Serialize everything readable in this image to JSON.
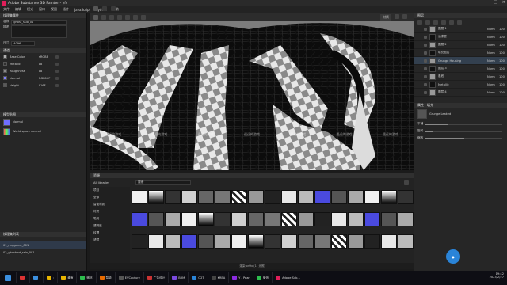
{
  "window": {
    "title": "Adobe Substance 3D Painter - yfs"
  },
  "menu": [
    "文件",
    "编辑",
    "模式",
    "窗口",
    "视图",
    "插件",
    "JavaScript",
    "Python",
    "帮助"
  ],
  "left": {
    "section_title": "纹理集属性",
    "name_label": "名称",
    "name_value": "ghost_sslo_01",
    "sub_label": "描述",
    "resolution_label": "尺寸",
    "resolution_value": "4096",
    "channels_title": "通道",
    "channels": [
      {
        "name": "Base Color",
        "type": "sRGB8",
        "color": "#b0b0b0"
      },
      {
        "name": "Metallic",
        "type": "L8",
        "color": "#303030"
      },
      {
        "name": "Roughness",
        "type": "L8",
        "color": "#8a8a8a"
      },
      {
        "name": "Normal",
        "type": "RGB16F",
        "color": "#8080ff"
      },
      {
        "name": "Height",
        "type": "L16F",
        "color": "#5a5a5a"
      }
    ],
    "maps_title": "模型贴图",
    "maps": [
      "Normal",
      "World space normal"
    ],
    "shelf_panel_title": "纹理集列表",
    "sets": [
      "01_ringgame_001",
      "02_ghostmd_sslo_001"
    ]
  },
  "viewport": {
    "toolbar_label": "材质",
    "watermarks": [
      "遥远的游戏",
      "遥远的游戏",
      "遥远的游戏",
      "遥远的游戏",
      "遥远的游戏",
      "遥远的游戏",
      "遥远的游戏"
    ]
  },
  "right": {
    "layers_title": "图层",
    "blend": "Norm",
    "layers": [
      {
        "name": "图层 1",
        "opacity": "100"
      },
      {
        "name": "油漆层",
        "opacity": "100"
      },
      {
        "name": "图层 2",
        "opacity": "100"
      },
      {
        "name": "填充图层",
        "opacity": "100"
      },
      {
        "name": "Grunge Housing",
        "opacity": "100"
      },
      {
        "name": "图层 3",
        "opacity": "100"
      },
      {
        "name": "基底",
        "opacity": "100"
      },
      {
        "name": "Metallic",
        "opacity": "100"
      },
      {
        "name": "图层 4",
        "opacity": "100"
      }
    ],
    "props_title": "属性 - 填充",
    "props_value": "Grunge Leaked",
    "slider_labels": [
      "平铺",
      "旋转",
      "缩放"
    ]
  },
  "shelf": {
    "title": "资源",
    "search_placeholder": "搜索",
    "filter": "All libraries",
    "categories": [
      "项目",
      "全部",
      "智能材质",
      "材质",
      "笔刷",
      "透明度",
      "纹理",
      "滤镜"
    ]
  },
  "status": {
    "text": "渲染 ortho(1) 光照"
  },
  "taskbar": {
    "items": [
      "",
      "",
      ":",
      "桌面",
      "微信",
      "智能",
      "EVCapture",
      "广告设计",
      "BRM",
      "Q2T",
      "KREA",
      "Y - Pear",
      "微信",
      "Adobe Sub..."
    ],
    "time": "19:42",
    "date": "2023/2/27"
  }
}
